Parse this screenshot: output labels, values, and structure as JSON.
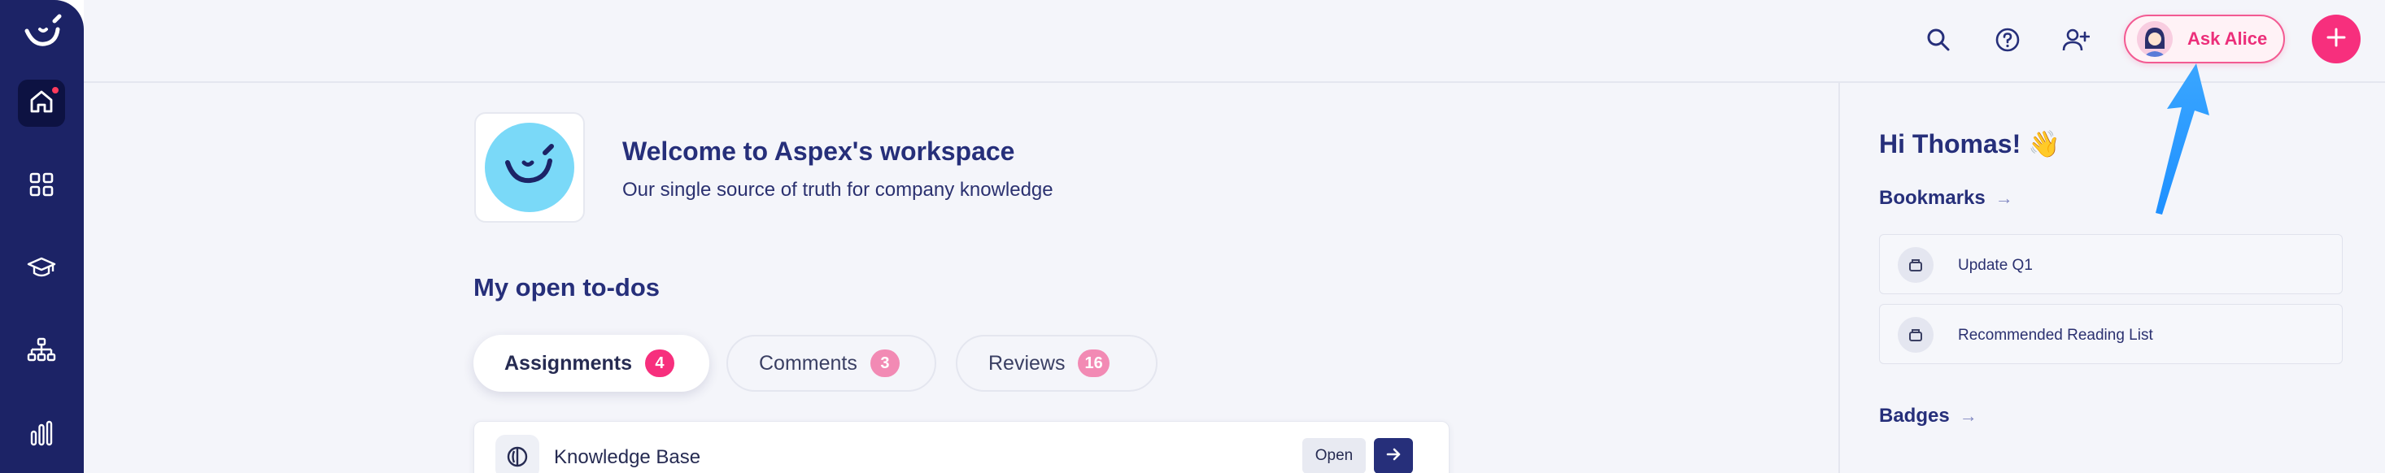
{
  "sidebar": {
    "logo_icon": "smile-logo-icon",
    "items": [
      {
        "icon": "home-icon",
        "active": true,
        "has_notification": true
      },
      {
        "icon": "grid-apps-icon",
        "active": false
      },
      {
        "icon": "graduation-cap-icon",
        "active": false
      },
      {
        "icon": "org-chart-icon",
        "active": false
      },
      {
        "icon": "bar-chart-icon",
        "active": false
      }
    ],
    "colors": {
      "background": "#1c2366",
      "active": "#0d1242",
      "notification": "#ff3b5c"
    }
  },
  "topbar": {
    "icons": [
      "search-icon",
      "help-icon",
      "add-user-icon"
    ],
    "ask_alice_label": "Ask Alice",
    "plus_icon": "plus-icon",
    "accent_color": "#f72f7d"
  },
  "workspace": {
    "title": "Welcome to Aspex's workspace",
    "subtitle": "Our single source of truth for company knowledge"
  },
  "todos": {
    "heading": "My open to-dos",
    "tabs": [
      {
        "label": "Assignments",
        "count": "4",
        "active": true
      },
      {
        "label": "Comments",
        "count": "3",
        "active": false
      },
      {
        "label": "Reviews",
        "count": "16",
        "active": false
      }
    ],
    "items": [
      {
        "label": "Knowledge Base",
        "open_label": "Open"
      }
    ]
  },
  "right_panel": {
    "greeting": "Hi Thomas! 👋",
    "bookmarks_heading": "Bookmarks",
    "bookmarks": [
      {
        "label": "Update Q1"
      },
      {
        "label": "Recommended Reading List"
      }
    ],
    "badges_heading": "Badges",
    "arrow_glyph": "→"
  },
  "annotation": {
    "color": "#1e90ff"
  }
}
